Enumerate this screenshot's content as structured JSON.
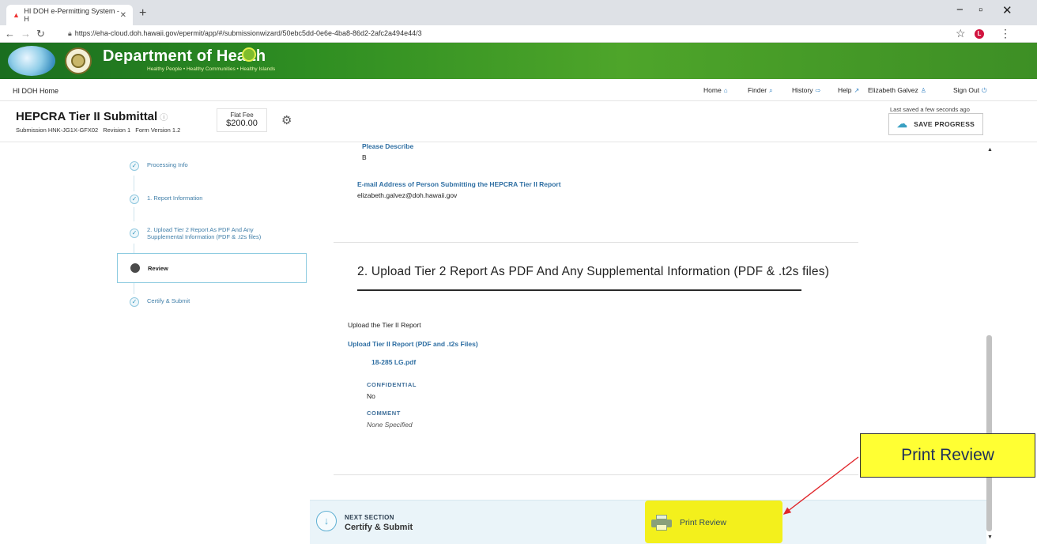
{
  "browser": {
    "tab_title": "HI DOH e-Permitting System - H",
    "new_tab": "+",
    "url": "https://eha-cloud.doh.hawaii.gov/epermit/app/#/submissionwizard/50ebc5dd-0e6e-4ba8-86d2-2afc2a494e44/3"
  },
  "site": {
    "title": "Department of Health",
    "tagline": "Healthy People • Healthy Communities • Healthy Islands",
    "brand": "HI DOH Home",
    "nav": [
      "Home",
      "Finder",
      "History",
      "Help",
      "Elizabeth Galvez",
      "Sign Out"
    ]
  },
  "submission": {
    "title": "HEPCRA Tier II Submittal",
    "id": "Submission HNK-JG1X-GFX02",
    "revision": "Revision 1",
    "form_version": "Form Version 1.2",
    "fee_label": "Flat Fee",
    "fee_amount": "$200.00",
    "saved_note": "Last saved a few seconds ago",
    "save_label": "SAVE PROGRESS"
  },
  "steps": [
    {
      "label": "Processing Info",
      "state": "done"
    },
    {
      "label": "1. Report Information",
      "state": "done"
    },
    {
      "label": "2. Upload Tier 2 Report As PDF And Any Supplemental Information (PDF & .t2s files)",
      "state": "done"
    },
    {
      "label": "Review",
      "state": "active"
    },
    {
      "label": "Certify & Submit",
      "state": "done"
    }
  ],
  "content": {
    "please_describe_label": "Please Describe",
    "please_describe_value": "B",
    "email_label": "E-mail Address of Person Submitting the HEPCRA Tier II Report",
    "email_value": "elizabeth.galvez@doh.hawaii.gov",
    "section_title": "2. Upload Tier 2 Report As PDF And Any Supplemental Information (PDF & .t2s files)",
    "upload_intro": "Upload the Tier II Report",
    "upload_label": "Upload Tier II Report (PDF and .t2s Files)",
    "file_name": "18-285 LG.pdf",
    "confidential_label": "CONFIDENTIAL",
    "confidential_value": "No",
    "comment_label": "COMMENT",
    "comment_value": "None Specified"
  },
  "bottom": {
    "next_label": "NEXT SECTION",
    "next_name": "Certify & Submit",
    "print_label": "Print Review"
  },
  "annotation": {
    "callout": "Print Review",
    "callout_color": "#ffff33",
    "arrow_color": "#e0262b"
  }
}
